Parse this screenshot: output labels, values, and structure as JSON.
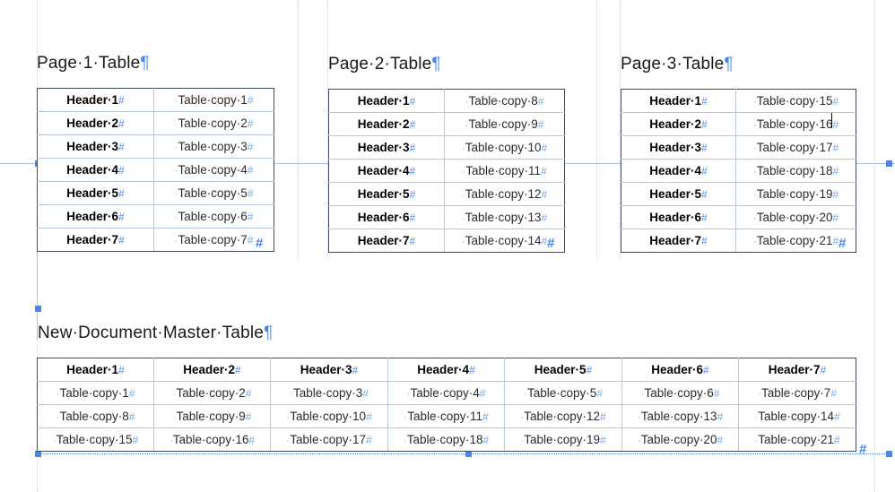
{
  "document": {
    "app_context": "word-processor-page-view",
    "formatting_marks_visible": true,
    "space_mark": "·",
    "paragraph_mark": "¶",
    "cell_end_mark": "#",
    "accent_color": "#4a86e8",
    "table_frame_color": "#3f4b5e",
    "table_inner_border_color": "#b7c6dd",
    "guide_color": "#c3d4ee"
  },
  "headings": {
    "page1": "Page·1·Table",
    "page2": "Page·2·Table",
    "page3": "Page·3·Table",
    "master": "New·Document·Master·Table"
  },
  "tables": {
    "page1": {
      "name": "Page 1 Table",
      "columns": 2,
      "rows": [
        {
          "header": "Header·1",
          "value": "Table·copy·1"
        },
        {
          "header": "Header·2",
          "value": "Table·copy·2"
        },
        {
          "header": "Header·3",
          "value": "Table·copy·3"
        },
        {
          "header": "Header·4",
          "value": "Table·copy·4"
        },
        {
          "header": "Header·5",
          "value": "Table·copy·5"
        },
        {
          "header": "Header·6",
          "value": "Table·copy·6"
        },
        {
          "header": "Header·7",
          "value": "Table·copy·7"
        }
      ]
    },
    "page2": {
      "name": "Page 2 Table",
      "columns": 2,
      "rows": [
        {
          "header": "Header·1",
          "value": "Table·copy·8"
        },
        {
          "header": "Header·2",
          "value": "Table·copy·9"
        },
        {
          "header": "Header·3",
          "value": "Table·copy·10"
        },
        {
          "header": "Header·4",
          "value": "Table·copy·11"
        },
        {
          "header": "Header·5",
          "value": "Table·copy·12"
        },
        {
          "header": "Header·6",
          "value": "Table·copy·13"
        },
        {
          "header": "Header·7",
          "value": "Table·copy·14"
        }
      ]
    },
    "page3": {
      "name": "Page 3 Table",
      "columns": 2,
      "rows": [
        {
          "header": "Header·1",
          "value": "Table·copy·15"
        },
        {
          "header": "Header·2",
          "value": "Table·copy·16"
        },
        {
          "header": "Header·3",
          "value": "Table·copy·17"
        },
        {
          "header": "Header·4",
          "value": "Table·copy·18"
        },
        {
          "header": "Header·5",
          "value": "Table·copy·19"
        },
        {
          "header": "Header·6",
          "value": "Table·copy·20"
        },
        {
          "header": "Header·7",
          "value": "Table·copy·21"
        }
      ]
    },
    "master": {
      "name": "New Document Master Table",
      "columns": 7,
      "header_row": [
        "Header·1",
        "Header·2",
        "Header·3",
        "Header·4",
        "Header·5",
        "Header·6",
        "Header·7"
      ],
      "body_rows": [
        [
          "Table·copy·1",
          "Table·copy·2",
          "Table·copy·3",
          "Table·copy·4",
          "Table·copy·5",
          "Table·copy·6",
          "Table·copy·7"
        ],
        [
          "Table·copy·8",
          "Table·copy·9",
          "Table·copy·10",
          "Table·copy·11",
          "Table·copy·12",
          "Table·copy·13",
          "Table·copy·14"
        ],
        [
          "Table·copy·15",
          "Table·copy·16",
          "Table·copy·17",
          "Table·copy·18",
          "Table·copy·19",
          "Table·copy·20",
          "Table·copy·21"
        ]
      ]
    }
  },
  "caret": {
    "located_in": "page3 table, row 2, value cell",
    "after_text": "Table·copy·16"
  }
}
